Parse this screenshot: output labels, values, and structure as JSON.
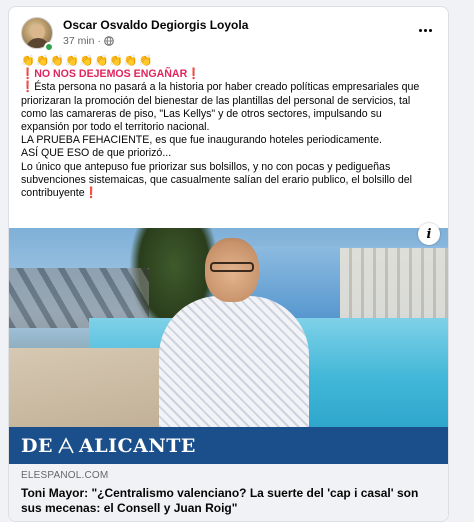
{
  "post": {
    "author": "Oscar Osvaldo Degiorgis Loyola",
    "time": "37 min",
    "separator": "·",
    "more_icon": "ellipsis-icon",
    "privacy_icon": "globe-icon",
    "lines": [
      "👏👏👏👏👏👏👏👏👏",
      "❗NO NOS DEJEMOS ENGAÑAR❗",
      "❗Ésta persona no pasará a la historia por haber creado políticas empresariales que",
      "priorizaran la promoción del bienestar de las plantillas del personal de servicios, tal",
      "como las camareras de piso, \"Las Kellys\" y de otros sectores, impulsando su",
      "expansión por todo el territorio nacional.",
      "LA PRUEBA FEHACIENTE, es que fue inaugurando hoteles periodicamente.",
      "ASÍ QUE ESO de que priorizó...",
      "Lo único que antepuso fue priorizar sus bolsillos, y no con pocas y pedigueñas",
      "subvenciones sistemaicas, que casualmente salían del erario publico, el bolsillo del",
      "contribuyente❗"
    ]
  },
  "image": {
    "banner_left": "DE",
    "banner_right": "ALICANTE",
    "info_icon": "info-icon"
  },
  "link": {
    "domain": "ELESPANOL.COM",
    "headline": "Toni Mayor: \"¿Centralismo valenciano? La suerte del 'cap i casal' son sus mecenas: el Consell y Juan Roig\""
  },
  "colors": {
    "accent": "#1b4f8c",
    "online": "#31a24c",
    "exclaim": "#e0245e"
  }
}
